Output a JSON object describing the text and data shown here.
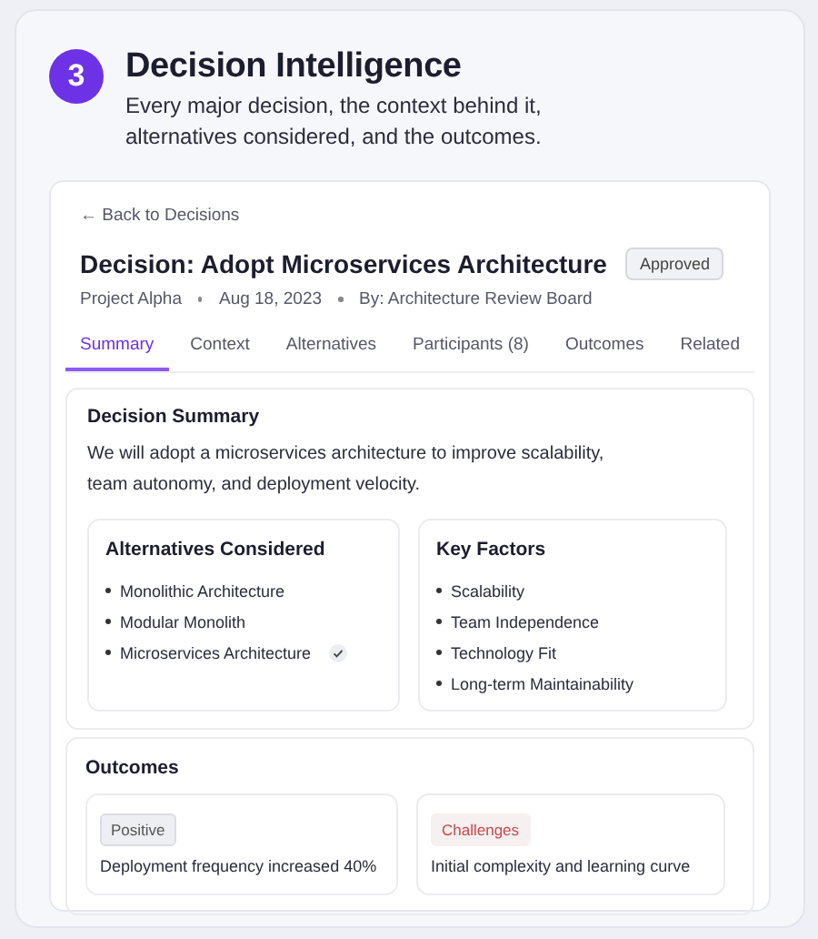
{
  "section": {
    "number": "3",
    "title": "Decision Intelligence",
    "subtitle_lines": [
      "Every major decision, the context behind it,",
      "alternatives considered, and the outcomes."
    ]
  },
  "back_link": "← Back to Decisions",
  "decision": {
    "title": "Decision: Adopt Microservices Architecture",
    "status": "Approved",
    "meta": [
      "Project Alpha",
      "Aug 18, 2023",
      "By: Architecture Review Board"
    ]
  },
  "tabs": [
    {
      "label": "Summary",
      "selected": true
    },
    {
      "label": "Context",
      "selected": false
    },
    {
      "label": "Alternatives",
      "selected": false
    },
    {
      "label": "Participants (8)",
      "selected": false
    },
    {
      "label": "Outcomes",
      "selected": false
    },
    {
      "label": "Related",
      "selected": false
    }
  ],
  "summary": {
    "title": "Decision Summary",
    "text_lines": [
      "We will adopt a microservices architecture to improve scalability,",
      "team autonomy, and deployment velocity."
    ],
    "alternatives": {
      "title": "Alternatives Considered",
      "items": [
        {
          "label": "Monolithic Architecture",
          "selected": false
        },
        {
          "label": "Modular Monolith",
          "selected": false
        },
        {
          "label": "Microservices Architecture",
          "selected": true
        }
      ]
    },
    "key_factors": {
      "title": "Key Factors",
      "items": [
        "Scalability",
        "Team Independence",
        "Technology Fit",
        "Long-term Maintainability"
      ]
    }
  },
  "outcomes": {
    "title": "Outcomes",
    "items": [
      {
        "kind": "positive",
        "tag": "Positive",
        "text": "Deployment frequency increased 40%"
      },
      {
        "kind": "challenge",
        "tag": "Challenges",
        "text": "Initial complexity and learning curve"
      }
    ]
  }
}
